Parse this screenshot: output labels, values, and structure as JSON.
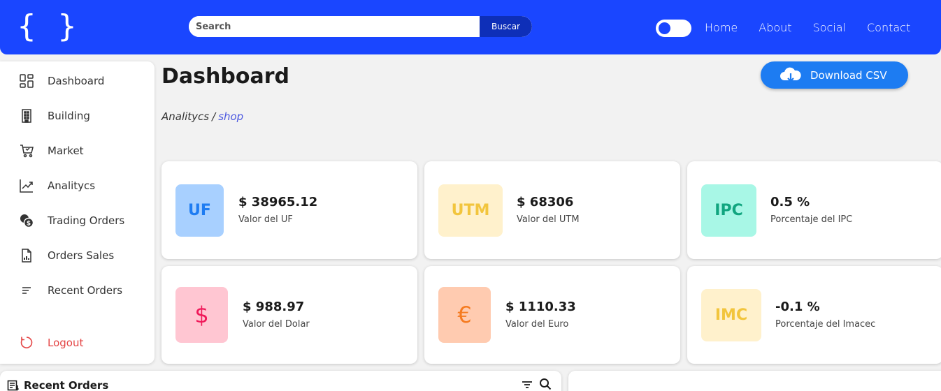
{
  "header": {
    "logo": "{ }",
    "search": {
      "placeholder": "Search",
      "value": "",
      "button_label": "Buscar"
    },
    "theme_toggle": {
      "state": "off"
    },
    "nav": [
      "Home",
      "About",
      "Social",
      "Contact"
    ]
  },
  "sidebar": {
    "items": [
      {
        "label": "Dashboard",
        "icon": "dashboard-icon"
      },
      {
        "label": "Building",
        "icon": "building-icon"
      },
      {
        "label": "Market",
        "icon": "cart-icon"
      },
      {
        "label": "Analitycs",
        "icon": "chart-line-icon"
      },
      {
        "label": "Trading Orders",
        "icon": "coins-icon"
      },
      {
        "label": "Orders Sales",
        "icon": "report-icon"
      },
      {
        "label": "Recent Orders",
        "icon": "sort-lines-icon"
      }
    ],
    "logout": {
      "label": "Logout",
      "icon": "logout-icon"
    }
  },
  "main": {
    "title": "Dashboard",
    "breadcrumb": {
      "parent": "Analitycs",
      "separator": "/",
      "current": "shop"
    },
    "download_button": {
      "label": "Download CSV",
      "icon": "cloud-download-icon"
    },
    "cards": [
      {
        "badge": "UF",
        "value": "$ 38965.12",
        "label": "Valor del UF",
        "badge_bg": "#a8d0ff",
        "badge_fg": "#1e7cf2"
      },
      {
        "badge": "UTM",
        "value": "$ 68306",
        "label": "Valor del UTM",
        "badge_bg": "#fff1cc",
        "badge_fg": "#f2c53d"
      },
      {
        "badge": "IPC",
        "value": "0.5 %",
        "label": "Porcentaje del IPC",
        "badge_bg": "#a8f7e6",
        "badge_fg": "#11a57f"
      },
      {
        "badge": "$",
        "value": "$ 988.97",
        "label": "Valor del Dolar",
        "badge_bg": "#ffc6d2",
        "badge_fg": "#f0195a"
      },
      {
        "badge": "€",
        "value": "$ 1110.33",
        "label": "Valor del Euro",
        "badge_bg": "#ffcbb0",
        "badge_fg": "#f57b20"
      },
      {
        "badge": "IMC",
        "value": "-0.1 %",
        "label": "Porcentaje del Imacec",
        "badge_bg": "#fff1cc",
        "badge_fg": "#f2c53d"
      }
    ]
  },
  "recent_orders": {
    "title": "Recent Orders",
    "icons": [
      "filter-icon",
      "search-icon"
    ]
  },
  "colors": {
    "primary": "#1a46ff",
    "accent": "#1d7cf2",
    "danger": "#e44545",
    "link": "#4b57e0"
  }
}
